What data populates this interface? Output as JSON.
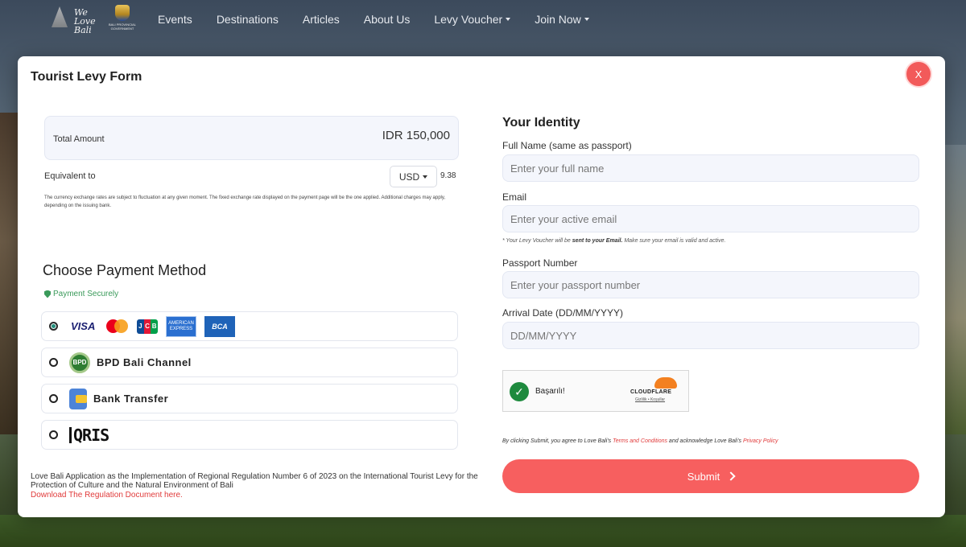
{
  "nav": {
    "logo_text": "We Love Bali",
    "gov_text": "BALI PROVINCIAL GOVERNMENT",
    "items": [
      {
        "label": "Events",
        "dropdown": false
      },
      {
        "label": "Destinations",
        "dropdown": false
      },
      {
        "label": "Articles",
        "dropdown": false
      },
      {
        "label": "About Us",
        "dropdown": false
      },
      {
        "label": "Levy Voucher",
        "dropdown": true
      },
      {
        "label": "Join Now",
        "dropdown": true
      }
    ]
  },
  "modal": {
    "title": "Tourist Levy Form",
    "close_label": "X",
    "amount": {
      "label": "Total Amount",
      "value": "IDR 150,000"
    },
    "equivalent": {
      "label": "Equivalent to",
      "currency": "USD",
      "value": "9.38"
    },
    "disclaimer": "The currency exchange rates are subject to fluctuation at any given moment. The fixed exchange rate displayed on the payment page will be the one applied. Additional charges may apply, depending on the issuing bank.",
    "payment": {
      "title": "Choose Payment Method",
      "secure_label": "Payment Securely",
      "options": [
        {
          "type": "cards",
          "selected": true,
          "visa": "VISA",
          "jcb": "JCB",
          "amex": "AMERICAN EXPRESS",
          "bca": "BCA"
        },
        {
          "type": "bpd",
          "selected": false,
          "label": "BPD Bali Channel"
        },
        {
          "type": "bank",
          "selected": false,
          "label": "Bank Transfer"
        },
        {
          "type": "qris",
          "selected": false,
          "label": "QRIS"
        }
      ]
    },
    "regulation": {
      "text": "Love Bali Application as the Implementation of Regional Regulation Number 6 of 2023 on the International Tourist Levy for the Protection of Culture and the Natural Environment of Bali",
      "link": "Download The Regulation Document here."
    },
    "identity": {
      "title": "Your Identity",
      "fields": {
        "name": {
          "label": "Full Name (same as passport)",
          "placeholder": "Enter your full name"
        },
        "email": {
          "label": "Email",
          "placeholder": "Enter your active email"
        },
        "passport": {
          "label": "Passport Number",
          "placeholder": "Enter your passport number"
        },
        "arrival": {
          "label": "Arrival Date (DD/MM/YYYY)",
          "placeholder": "DD/MM/YYYY"
        }
      },
      "email_note_prefix": "* Your Levy Voucher will be ",
      "email_note_bold": "sent to your Email.",
      "email_note_suffix": " Make sure your email is valid and active."
    },
    "captcha": {
      "status": "Başarılı!",
      "brand": "CLOUDFLARE",
      "links": "Gizlilik • Koşullar"
    },
    "agreement": {
      "prefix": "By clicking Submit, you agree to Love Bali's ",
      "terms": "Terms and Conditions",
      "middle": " and acknowledge Love Bali's ",
      "privacy": "Privacy Policy"
    },
    "submit_label": "Submit"
  },
  "colors": {
    "accent": "#f75f5f",
    "secure_green": "#3a9a5a",
    "link_red": "#e03a3a"
  }
}
